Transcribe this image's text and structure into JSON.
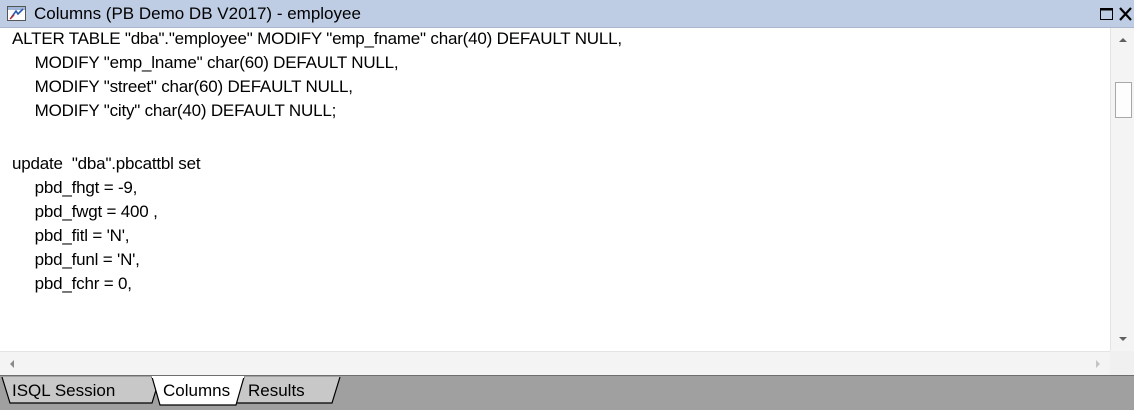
{
  "window": {
    "title": "Columns (PB Demo DB V2017) - employee",
    "title_icon": "columns-icon"
  },
  "editor": {
    "lines": [
      "ALTER TABLE \"dba\".\"employee\" MODIFY \"emp_fname\" char(40) DEFAULT NULL,",
      "     MODIFY \"emp_lname\" char(60) DEFAULT NULL,",
      "     MODIFY \"street\" char(60) DEFAULT NULL,",
      "     MODIFY \"city\" char(40) DEFAULT NULL;",
      "",
      "update  \"dba\".pbcattbl set",
      "     pbd_fhgt = -9,",
      "     pbd_fwgt = 400 ,",
      "     pbd_fitl = 'N',",
      "     pbd_funl = 'N',",
      "     pbd_fchr = 0,"
    ]
  },
  "tabs": [
    {
      "label": "ISQL Session",
      "active": false
    },
    {
      "label": "Columns",
      "active": true
    },
    {
      "label": "Results",
      "active": false
    }
  ],
  "colors": {
    "titlebar": "#bfcde4",
    "tabbar": "#a0a0a0",
    "scrollbar": "#f4f4f4"
  }
}
